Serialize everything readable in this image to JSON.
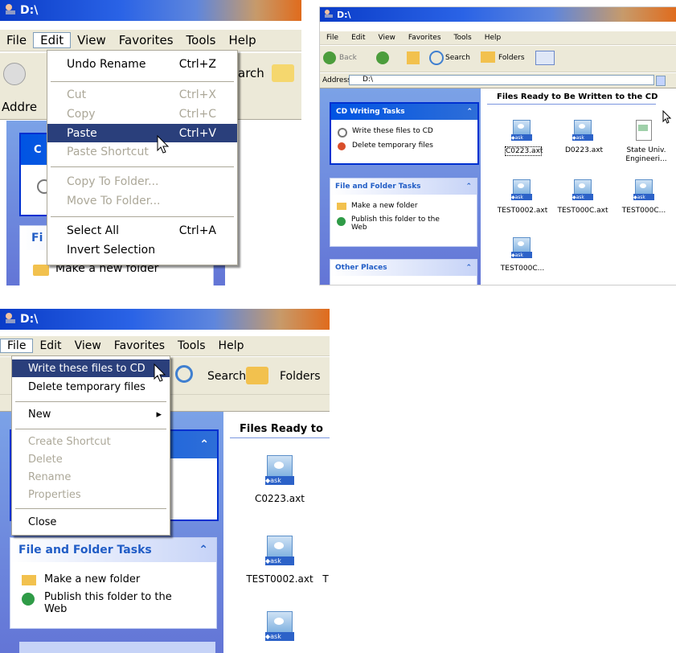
{
  "panel_a": {
    "title": "D:\\",
    "menus": [
      "File",
      "Edit",
      "View",
      "Favorites",
      "Tools",
      "Help"
    ],
    "toolbar_partial": "arch",
    "address_partial": "Addre",
    "edit_menu": [
      {
        "label": "Undo Rename",
        "shortcut": "Ctrl+Z",
        "state": "normal"
      },
      {
        "label": "Cut",
        "shortcut": "Ctrl+X",
        "state": "disabled"
      },
      {
        "label": "Copy",
        "shortcut": "Ctrl+C",
        "state": "disabled"
      },
      {
        "label": "Paste",
        "shortcut": "Ctrl+V",
        "state": "highlight"
      },
      {
        "label": "Paste Shortcut",
        "shortcut": "",
        "state": "disabled"
      },
      {
        "label": "Copy To Folder...",
        "shortcut": "",
        "state": "disabled"
      },
      {
        "label": "Move To Folder...",
        "shortcut": "",
        "state": "disabled"
      },
      {
        "label": "Select All",
        "shortcut": "Ctrl+A",
        "state": "normal"
      },
      {
        "label": "Invert Selection",
        "shortcut": "",
        "state": "normal"
      }
    ],
    "task_partial_1": "C",
    "task_partial_2": "Fi",
    "make_folder": "Make a new folder"
  },
  "panel_b": {
    "title": "D:\\",
    "menus": [
      "File",
      "Edit",
      "View",
      "Favorites",
      "Tools",
      "Help"
    ],
    "back": "Back",
    "search": "Search",
    "folders": "Folders",
    "address_label": "Address",
    "address_value": "D:\\",
    "cd_tasks": {
      "title": "CD Writing Tasks",
      "items": [
        "Write these files to CD",
        "Delete temporary files"
      ]
    },
    "file_tasks": {
      "title": "File and Folder Tasks",
      "items": [
        "Make a new folder",
        "Publish this folder to the Web"
      ]
    },
    "other_places": "Other Places",
    "section_title": "Files Ready to Be Written to the CD",
    "files": [
      "C0223.axt",
      "D0223.axt",
      "State Univ. Engineeri...",
      "TEST0002.axt",
      "TEST000C.axt",
      "TEST000C...",
      "TEST000C..."
    ]
  },
  "panel_c": {
    "title": "D:\\",
    "menus": [
      "File",
      "Edit",
      "View",
      "Favorites",
      "Tools",
      "Help"
    ],
    "search": "Search",
    "folders": "Folders",
    "file_menu": [
      {
        "label": "Write these files to CD",
        "state": "highlight"
      },
      {
        "label": "Delete temporary files",
        "state": "normal"
      },
      {
        "label": "New",
        "state": "normal",
        "submenu": "▸"
      },
      {
        "label": "Create Shortcut",
        "state": "disabled"
      },
      {
        "label": "Delete",
        "state": "disabled"
      },
      {
        "label": "Rename",
        "state": "disabled"
      },
      {
        "label": "Properties",
        "state": "disabled"
      },
      {
        "label": "Close",
        "state": "normal"
      }
    ],
    "section_title": "Files Ready to",
    "file_tasks": {
      "title": "File and Folder Tasks",
      "items": [
        "Make a new folder",
        "Publish this folder to the Web"
      ]
    },
    "files": [
      "C0223.axt",
      "TEST0002.axt",
      "T"
    ]
  },
  "colors": {
    "highlight": "#2a3f7b",
    "menu_bg": "#ece9d8",
    "task_blue": "#215dc6"
  }
}
